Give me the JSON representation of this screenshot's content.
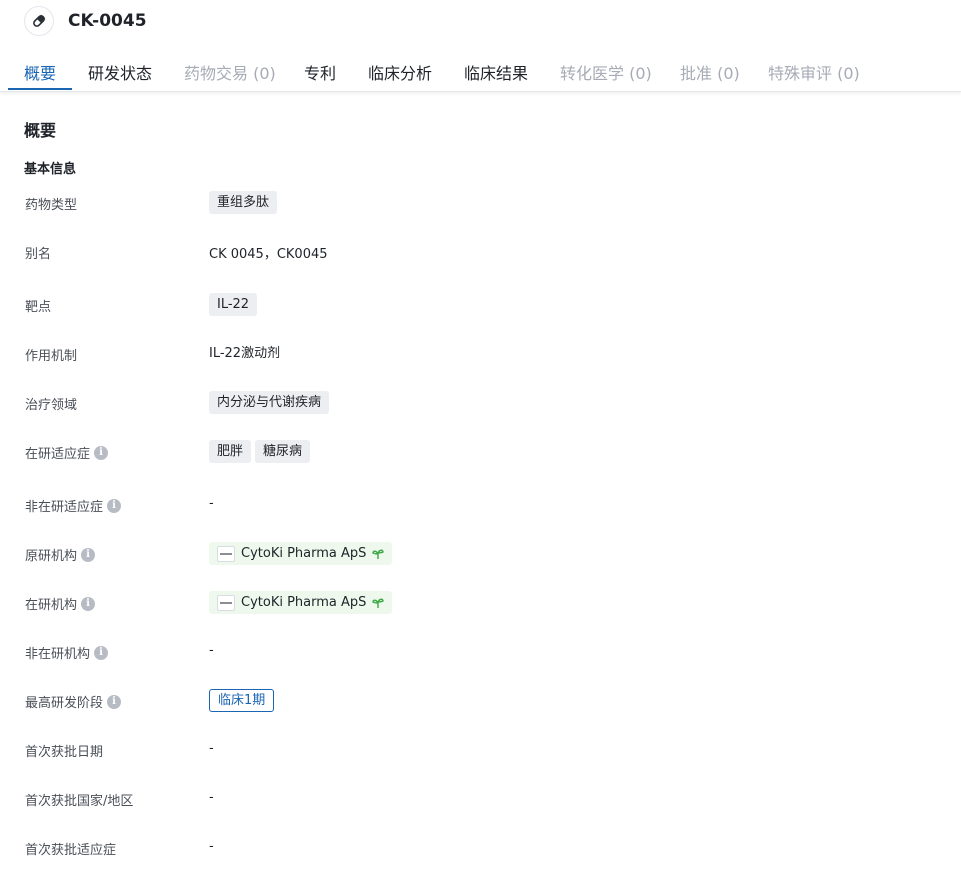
{
  "header": {
    "title": "CK-0045",
    "icon": "pill-icon"
  },
  "tabs": [
    {
      "label": "概要",
      "state": "active"
    },
    {
      "label": "研发状态",
      "state": "normal"
    },
    {
      "label": "药物交易 (0)",
      "state": "disabled"
    },
    {
      "label": "专利",
      "state": "normal"
    },
    {
      "label": "临床分析",
      "state": "normal"
    },
    {
      "label": "临床结果",
      "state": "normal"
    },
    {
      "label": "转化医学 (0)",
      "state": "disabled"
    },
    {
      "label": "批准 (0)",
      "state": "disabled"
    },
    {
      "label": "特殊审评 (0)",
      "state": "disabled"
    }
  ],
  "section": {
    "title": "概要",
    "subtitle": "基本信息"
  },
  "fields": {
    "drug_type": {
      "label": "药物类型",
      "tags": [
        "重组多肽"
      ]
    },
    "alias": {
      "label": "别名",
      "value": "CK 0045，CK0045"
    },
    "target": {
      "label": "靶点",
      "tags": [
        "IL-22"
      ]
    },
    "mechanism": {
      "label": "作用机制",
      "value": "IL-22激动剂"
    },
    "therapeutic_area": {
      "label": "治疗领域",
      "tags": [
        "内分泌与代谢疾病"
      ]
    },
    "active_indications": {
      "label": "在研适应症",
      "tags": [
        "肥胖",
        "糖尿病"
      ]
    },
    "inactive_indications": {
      "label": "非在研适应症",
      "value": "-"
    },
    "originator": {
      "label": "原研机构",
      "org": "CytoKi Pharma ApS"
    },
    "active_org": {
      "label": "在研机构",
      "org": "CytoKi Pharma ApS"
    },
    "inactive_org": {
      "label": "非在研机构",
      "value": "-"
    },
    "highest_phase": {
      "label": "最高研发阶段",
      "phase": "临床1期"
    },
    "first_approval_date": {
      "label": "首次获批日期",
      "value": "-"
    },
    "first_approval_region": {
      "label": "首次获批国家/地区",
      "value": "-"
    },
    "first_approval_indication": {
      "label": "首次获批适应症",
      "value": "-"
    }
  },
  "colors": {
    "accent": "#1a66b3",
    "disabled_tab": "#a6abb5",
    "org_tag_bg": "#eef8ec",
    "tag_bg": "#eceef2",
    "sprout": "#3aa845"
  }
}
